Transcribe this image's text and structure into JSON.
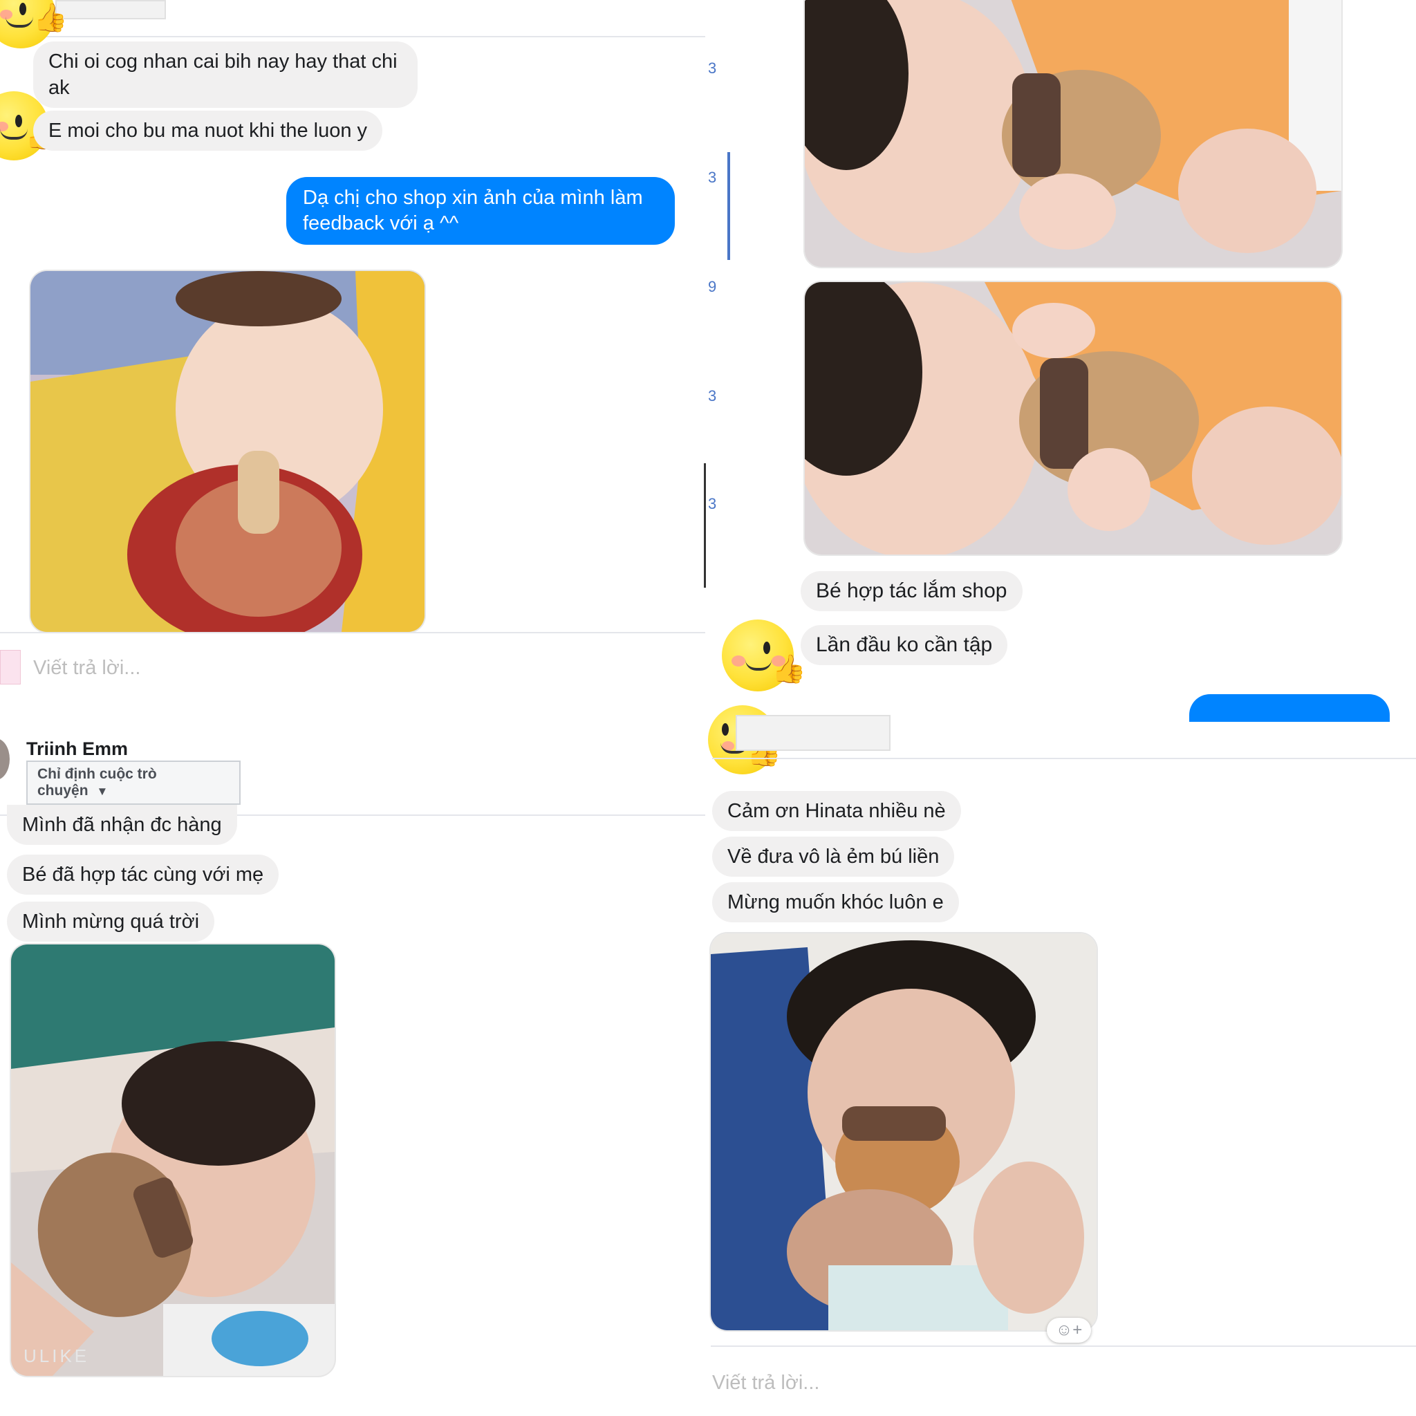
{
  "panel_top_left": {
    "messages_in": [
      "Chi oi cog nhan cai bih nay hay that chi\nak",
      "E moi cho bu ma nuot khi the luon y"
    ],
    "message_out": "Dạ chị cho shop xin ảnh của mình làm feedback với ạ ^^",
    "reply_placeholder": "Viết trả lời..."
  },
  "panel_top_right": {
    "messages_in": [
      "Bé hợp tác  lắm  shop",
      "Lần  đầu  ko cần tập"
    ]
  },
  "panel_bottom_left": {
    "contact_name": "Triinh Emm",
    "assign_label": "Chỉ định cuộc trò chuyện",
    "messages_in": [
      "Mình đã nhận đc hàng",
      "Bé đã hợp tác cùng với mẹ",
      "Mình mừng quá trời"
    ],
    "watermark": "ULIKE"
  },
  "panel_bottom_right": {
    "messages_in": [
      "Cảm ơn Hinata nhiều nè",
      "Về đưa vô là ẻm bú liền",
      "Mừng muốn khóc luôn e"
    ],
    "reply_placeholder": "Viết trả lời...",
    "react_label": "☺+"
  },
  "icons": {
    "emoji": "winking-thumbs-up-emoji-icon",
    "caret": "caret-down-icon",
    "add_reaction": "add-reaction-icon"
  },
  "colors": {
    "outgoing_bubble": "#0084ff",
    "incoming_bubble": "#f1f0f0",
    "accent_line": "#4a76c7"
  }
}
